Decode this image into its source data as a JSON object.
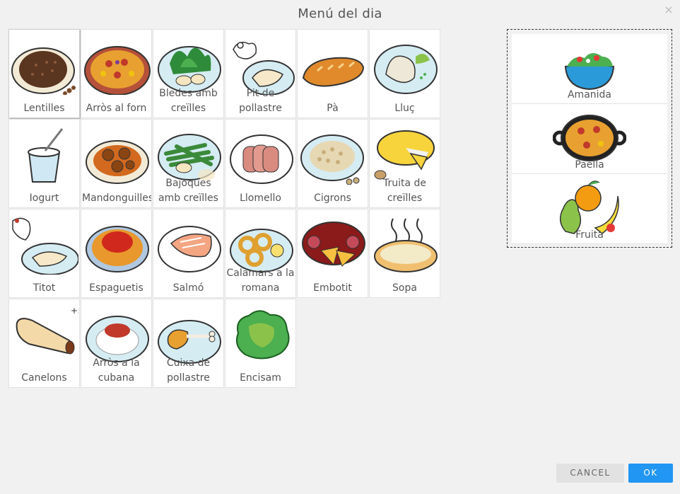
{
  "dialog": {
    "title": "Menú del dia",
    "close_label": "×"
  },
  "grid": {
    "items": [
      {
        "label": "Lentilles",
        "icon": "lentils-icon"
      },
      {
        "label": "Arròs al forn",
        "icon": "baked-rice-icon"
      },
      {
        "label": "Bledes amb creïlles",
        "icon": "chard-potatoes-icon"
      },
      {
        "label": "Pit de pollastre",
        "icon": "chicken-breast-icon"
      },
      {
        "label": "Pà",
        "icon": "bread-icon"
      },
      {
        "label": "Lluç",
        "icon": "hake-icon"
      },
      {
        "label": "Iogurt",
        "icon": "yogurt-icon"
      },
      {
        "label": "Mandonguilles",
        "icon": "meatballs-icon"
      },
      {
        "label": "Bajoques amb creïlles",
        "icon": "green-beans-potatoes-icon"
      },
      {
        "label": "Llomello",
        "icon": "pork-loin-icon"
      },
      {
        "label": "Cigrons",
        "icon": "chickpeas-icon"
      },
      {
        "label": "Truita de creïlles",
        "icon": "potato-omelette-icon"
      },
      {
        "label": "Titot",
        "icon": "turkey-icon"
      },
      {
        "label": "Espaguetis",
        "icon": "spaghetti-icon"
      },
      {
        "label": "Salmó",
        "icon": "salmon-icon"
      },
      {
        "label": "Calamars a la romana",
        "icon": "calamari-icon"
      },
      {
        "label": "Embotit",
        "icon": "cold-cuts-icon"
      },
      {
        "label": "Sopa",
        "icon": "soup-icon"
      },
      {
        "label": "Canelons",
        "icon": "cannelloni-icon"
      },
      {
        "label": "Arròs a la cubana",
        "icon": "cuban-rice-icon"
      },
      {
        "label": "Cuixa de pollastre",
        "icon": "chicken-leg-icon"
      },
      {
        "label": "Encisam",
        "icon": "lettuce-icon"
      }
    ]
  },
  "selected": {
    "items": [
      {
        "label": "Amanida",
        "icon": "salad-icon"
      },
      {
        "label": "Paella",
        "icon": "paella-icon"
      },
      {
        "label": "Fruita",
        "icon": "fruit-icon"
      }
    ]
  },
  "buttons": {
    "cancel_label": "CANCEL",
    "ok_label": "OK"
  },
  "colors": {
    "accent": "#2196f3",
    "cancel_bg": "#e2e2e2",
    "background": "#f1f1f1"
  }
}
